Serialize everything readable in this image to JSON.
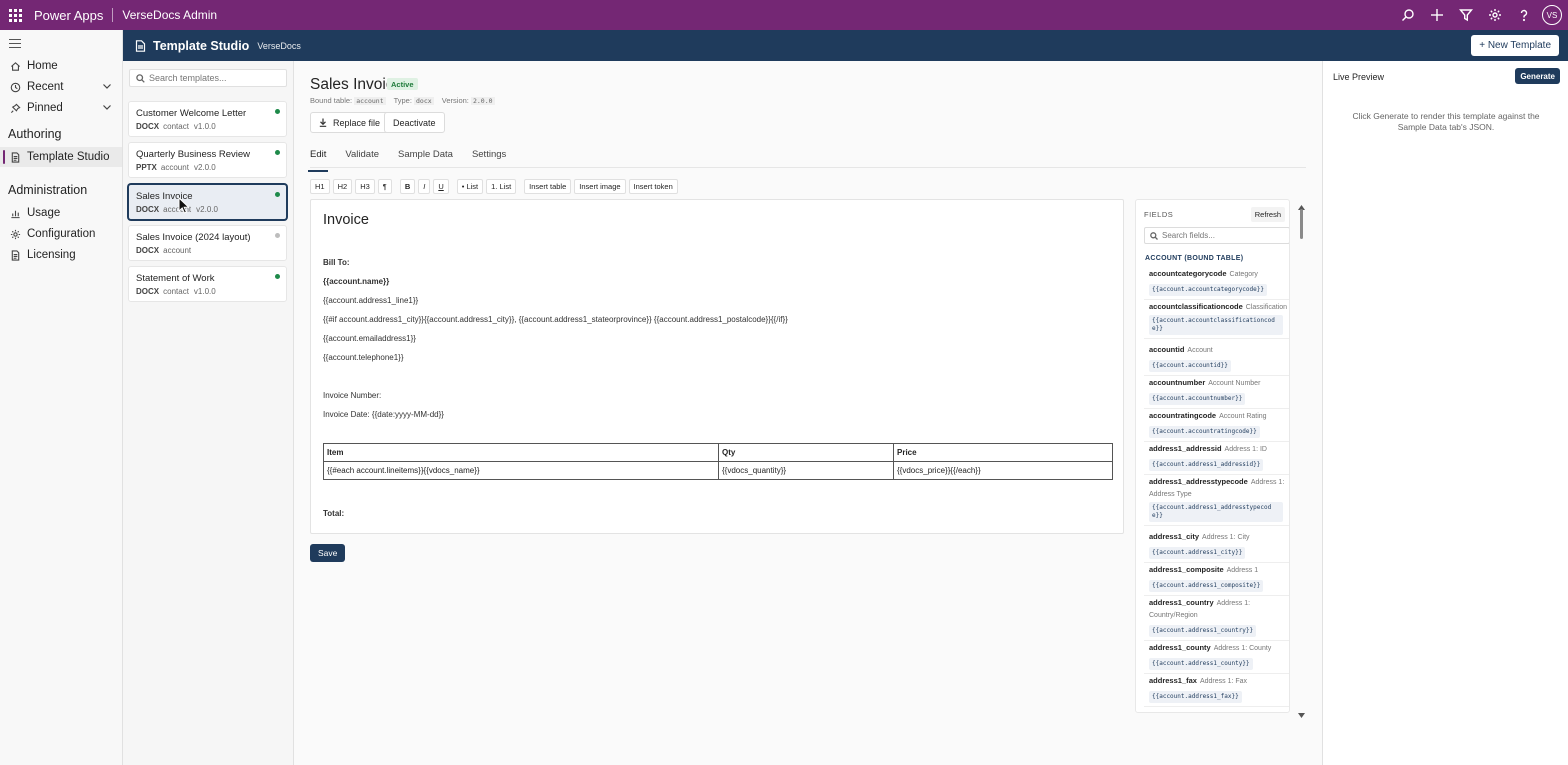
{
  "topbar": {
    "app_name": "Power Apps",
    "environment": "VerseDocs Admin",
    "avatar_initials": "VS",
    "icons": [
      "search-icon",
      "plus-icon",
      "filter-icon",
      "gear-icon",
      "help-icon"
    ]
  },
  "leftnav": {
    "items": [
      {
        "label": "Home",
        "icon": "home-icon"
      },
      {
        "label": "Recent",
        "icon": "clock-icon"
      },
      {
        "label": "Pinned",
        "icon": "pin-icon"
      }
    ],
    "authoring_heading": "Authoring",
    "authoring_items": [
      {
        "label": "Template Studio",
        "icon": "document-icon",
        "selected": true
      }
    ],
    "administration_heading": "Administration",
    "administration_items": [
      {
        "label": "Usage",
        "icon": "chart-icon"
      },
      {
        "label": "Configuration",
        "icon": "gear-icon"
      },
      {
        "label": "Licensing",
        "icon": "document-icon"
      }
    ]
  },
  "studio_header": {
    "title": "Template Studio",
    "subtitle": "VerseDocs",
    "new_template_label": "+ New Template"
  },
  "templates": {
    "search_placeholder": "Search templates...",
    "items": [
      {
        "name": "Customer Welcome Letter",
        "type": "DOCX",
        "table": "contact",
        "version": "v1.0.0",
        "active": true
      },
      {
        "name": "Quarterly Business Review",
        "type": "PPTX",
        "table": "account",
        "version": "v2.0.0",
        "active": true
      },
      {
        "name": "Sales Invoice",
        "type": "DOCX",
        "table": "account",
        "version": "v2.0.0",
        "active": true,
        "selected": true
      },
      {
        "name": "Sales Invoice (2024 layout)",
        "type": "DOCX",
        "table": "account",
        "version": "",
        "active": false
      },
      {
        "name": "Statement of Work",
        "type": "DOCX",
        "table": "contact",
        "version": "v1.0.0",
        "active": true
      }
    ]
  },
  "editor": {
    "title": "Sales Invoice",
    "status": "Active",
    "meta": {
      "bound_label": "Bound table:",
      "bound_value": "account",
      "type_label": "Type:",
      "type_value": "docx",
      "version_label": "Version:",
      "version_value": "2.0.0"
    },
    "replace_file_label": "Replace file",
    "deactivate_label": "Deactivate",
    "tabs": [
      "Edit",
      "Validate",
      "Sample Data",
      "Settings"
    ],
    "active_tab": "Edit",
    "toolbar": {
      "h1": "H1",
      "h2": "H2",
      "h3": "H3",
      "para": "¶",
      "bold": "B",
      "italic": "I",
      "underline": "U",
      "bullet_list": "• List",
      "numbered_list": "1. List",
      "insert_table": "Insert table",
      "insert_image": "Insert image",
      "insert_token": "Insert token"
    },
    "doc": {
      "heading": "Invoice",
      "bill_to": "Bill To:",
      "name_token": "{{account.name}}",
      "line1": "{{account.address1_line1}}",
      "city_line": "{{#if account.address1_city}}{{account.address1_city}}, {{account.address1_stateorprovince}} {{account.address1_postalcode}}{{/if}}",
      "email": "{{account.emailaddress1}}",
      "phone": "{{account.telephone1}}",
      "invoice_number": "Invoice Number:",
      "invoice_date": "Invoice Date: {{date:yyyy-MM-dd}}",
      "table": {
        "headers": [
          "Item",
          "Qty",
          "Price"
        ],
        "row": [
          "{{#each account.lineitems}}{{vdocs_name}}",
          "{{vdocs_quantity}}",
          "{{vdocs_price}}{{/each}}"
        ]
      },
      "total": "Total:"
    },
    "save_label": "Save"
  },
  "fields": {
    "title": "FIELDS",
    "refresh_label": "Refresh",
    "search_placeholder": "Search fields...",
    "section": "ACCOUNT (BOUND TABLE)",
    "items": [
      {
        "name": "accountcategorycode",
        "display": "Category",
        "token": "{{account.accountcategorycode}}"
      },
      {
        "name": "accountclassificationcode",
        "display": "Classification",
        "token": "{{account.accountclassificationcode}}"
      },
      {
        "name": "accountid",
        "display": "Account",
        "token": "{{account.accountid}}"
      },
      {
        "name": "accountnumber",
        "display": "Account Number",
        "token": "{{account.accountnumber}}"
      },
      {
        "name": "accountratingcode",
        "display": "Account Rating",
        "token": "{{account.accountratingcode}}"
      },
      {
        "name": "address1_addressid",
        "display": "Address 1: ID",
        "token": "{{account.address1_addressid}}"
      },
      {
        "name": "address1_addresstypecode",
        "display": "Address 1: Address Type",
        "token": "{{account.address1_addresstypecode}}"
      },
      {
        "name": "address1_city",
        "display": "Address 1: City",
        "token": "{{account.address1_city}}"
      },
      {
        "name": "address1_composite",
        "display": "Address 1",
        "token": "{{account.address1_composite}}"
      },
      {
        "name": "address1_country",
        "display": "Address 1: Country/Region",
        "token": "{{account.address1_country}}"
      },
      {
        "name": "address1_county",
        "display": "Address 1: County",
        "token": "{{account.address1_county}}"
      },
      {
        "name": "address1_fax",
        "display": "Address 1: Fax",
        "token": "{{account.address1_fax}}"
      }
    ]
  },
  "preview": {
    "title": "Live Preview",
    "generate_label": "Generate",
    "hint": "Click Generate to render this template against the Sample Data tab's JSON."
  },
  "colors": {
    "topbar": "#742774",
    "header": "#1f3b5c",
    "active_dot": "#1e8a4a"
  }
}
